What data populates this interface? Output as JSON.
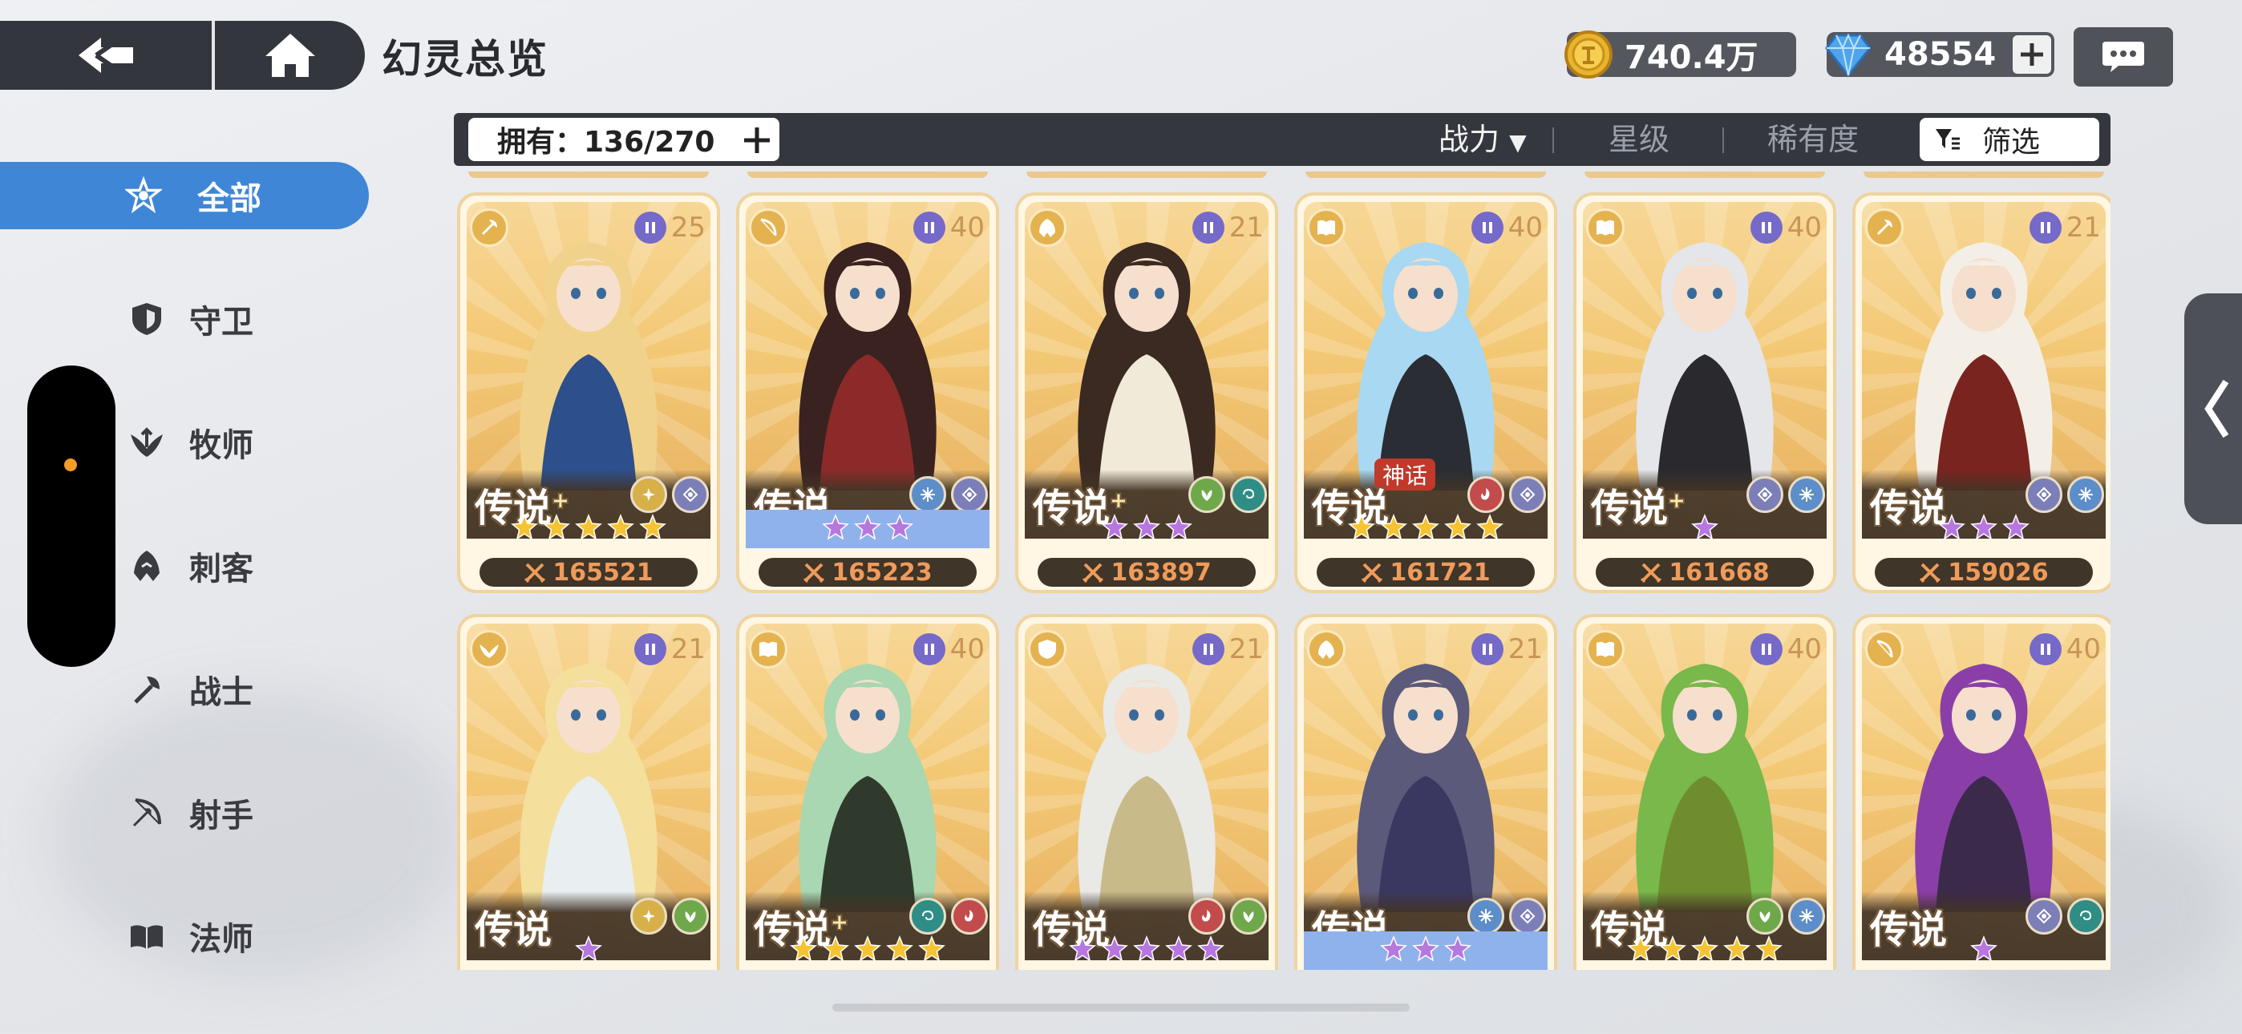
{
  "header": {
    "title": "幻灵总览",
    "gold": "740.4万",
    "gems": "48554"
  },
  "filter_bar": {
    "own_label": "拥有：136/270",
    "sort_power": "战力",
    "sort_star": "星级",
    "sort_rarity": "稀有度",
    "filter_label": "筛选"
  },
  "sidebar": {
    "items": [
      {
        "label": "全部",
        "icon": "all-classes-icon",
        "active": true
      },
      {
        "label": "守卫",
        "icon": "shield-icon",
        "active": false
      },
      {
        "label": "牧师",
        "icon": "priest-icon",
        "active": false
      },
      {
        "label": "刺客",
        "icon": "assassin-icon",
        "active": false
      },
      {
        "label": "战士",
        "icon": "warrior-icon",
        "active": false
      },
      {
        "label": "射手",
        "icon": "bow-icon",
        "active": false
      },
      {
        "label": "法师",
        "icon": "book-icon",
        "active": false
      }
    ]
  },
  "cards": [
    {
      "class": "warrior",
      "level": "25",
      "rarity": "传说",
      "plus": true,
      "stars": 5,
      "star_color": "gold",
      "star_strip": "none",
      "elements": [
        "light",
        "void"
      ],
      "power": "165521",
      "hair": "#f1d28a",
      "outfit": "#2d4f8c"
    },
    {
      "class": "archer",
      "level": "40",
      "rarity": "传说",
      "plus": false,
      "stars": 3,
      "star_color": "purple",
      "star_strip": "blue",
      "elements": [
        "ice",
        "void"
      ],
      "power": "165223",
      "hair": "#3a2220",
      "outfit": "#8c2a2a"
    },
    {
      "class": "assassin",
      "level": "21",
      "rarity": "传说",
      "plus": true,
      "stars": 3,
      "star_color": "purple",
      "star_strip": "none",
      "elements": [
        "nature",
        "wind"
      ],
      "power": "163897",
      "hair": "#3b2a22",
      "outfit": "#f1ead8"
    },
    {
      "class": "mage",
      "level": "40",
      "rarity": "传说",
      "plus": false,
      "stars": 5,
      "star_color": "gold",
      "star_strip": "none",
      "elements": [
        "fire",
        "void"
      ],
      "power": "161721",
      "hair": "#a9d8f2",
      "outfit": "#2a2d33",
      "myth": "神话"
    },
    {
      "class": "mage",
      "level": "40",
      "rarity": "传说",
      "plus": true,
      "stars": 1,
      "star_color": "purple",
      "star_strip": "none",
      "elements": [
        "void",
        "ice"
      ],
      "power": "161668",
      "hair": "#e4e6ea",
      "outfit": "#2a2a2e"
    },
    {
      "class": "warrior",
      "level": "21",
      "rarity": "传说",
      "plus": false,
      "stars": 3,
      "star_color": "purple",
      "star_strip": "none",
      "elements": [
        "void",
        "ice"
      ],
      "power": "159026",
      "hair": "#f3efe6",
      "outfit": "#7a2420"
    },
    {
      "class": "priest",
      "level": "21",
      "rarity": "传说",
      "plus": false,
      "stars": 1,
      "star_color": "purple",
      "star_strip": "none",
      "elements": [
        "light",
        "nature"
      ],
      "power": "",
      "hair": "#f4df9c",
      "outfit": "#e9eef0"
    },
    {
      "class": "mage",
      "level": "40",
      "rarity": "传说",
      "plus": true,
      "stars": 5,
      "star_color": "gold",
      "star_strip": "none",
      "elements": [
        "wind",
        "fire"
      ],
      "power": "",
      "hair": "#a8d7b1",
      "outfit": "#2f3a2d"
    },
    {
      "class": "guard",
      "level": "21",
      "rarity": "传说",
      "plus": false,
      "stars": 5,
      "star_color": "purple",
      "star_strip": "none",
      "elements": [
        "fire",
        "nature"
      ],
      "power": "",
      "hair": "#e9e9e6",
      "outfit": "#c9ba8a"
    },
    {
      "class": "assassin",
      "level": "21",
      "rarity": "传说",
      "plus": false,
      "stars": 3,
      "star_color": "purple",
      "star_strip": "blue",
      "elements": [
        "ice",
        "void"
      ],
      "power": "",
      "hair": "#5b5a7a",
      "outfit": "#3a3860"
    },
    {
      "class": "mage",
      "level": "40",
      "rarity": "传说",
      "plus": false,
      "stars": 5,
      "star_color": "gold",
      "star_strip": "none",
      "elements": [
        "nature",
        "ice"
      ],
      "power": "",
      "hair": "#79b84a",
      "outfit": "#6f8d2f"
    },
    {
      "class": "archer",
      "level": "40",
      "rarity": "传说",
      "plus": false,
      "stars": 1,
      "star_color": "purple",
      "star_strip": "none",
      "elements": [
        "void",
        "wind"
      ],
      "power": "",
      "hair": "#8a3fa8",
      "outfit": "#3c2a4a"
    }
  ],
  "colors": {
    "accent": "#3f86d6",
    "bar": "#35373e",
    "star_gold": "#f6c431",
    "star_purple": "#b777e0",
    "power_text": "#f09b5a"
  }
}
